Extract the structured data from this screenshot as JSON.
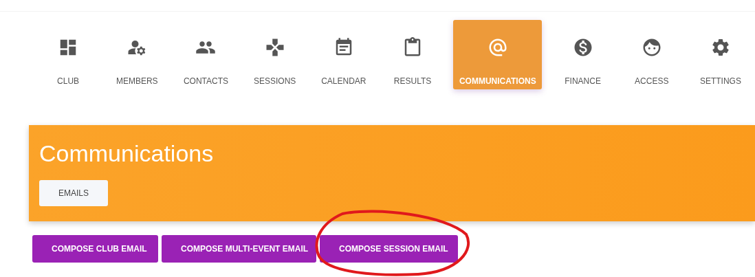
{
  "nav": [
    {
      "label": "CLUB",
      "selected": false
    },
    {
      "label": "MEMBERS",
      "selected": false
    },
    {
      "label": "CONTACTS",
      "selected": false
    },
    {
      "label": "SESSIONS",
      "selected": false
    },
    {
      "label": "CALENDAR",
      "selected": false
    },
    {
      "label": "RESULTS",
      "selected": false
    },
    {
      "label": "COMMUNICATIONS",
      "selected": true
    },
    {
      "label": "FINANCE",
      "selected": false
    },
    {
      "label": "ACCESS",
      "selected": false
    },
    {
      "label": "SETTINGS",
      "selected": false
    }
  ],
  "header": {
    "title": "Communications",
    "tabs": [
      {
        "label": "EMAILS"
      }
    ]
  },
  "actions": [
    "COMPOSE CLUB EMAIL",
    "COMPOSE MULTI-EVENT EMAIL",
    "COMPOSE SESSION EMAIL"
  ]
}
